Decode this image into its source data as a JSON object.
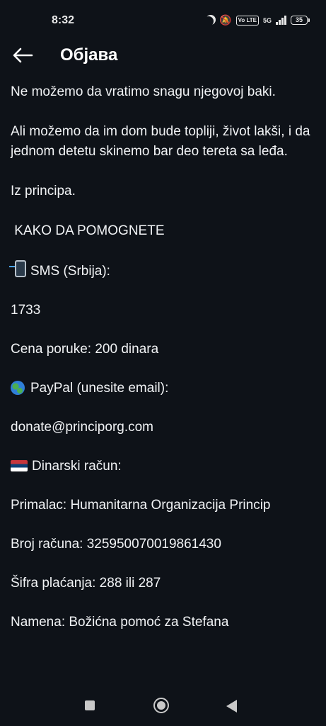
{
  "status_bar": {
    "time": "8:32",
    "network": "5G",
    "volte": "Vo LTE",
    "battery": "35"
  },
  "header": {
    "title": "Објава"
  },
  "post": {
    "line1": "Ne možemo da vratimo snagu njegovoj baki.",
    "para2": "Ali možemo da im dom bude topliji, život lakši, i da jednom detetu skinemo bar deo tereta sa leđa.",
    "para3": "Iz principa.",
    "heading": " KAKO DA POMOGNETE",
    "sms_label": "SMS (Srbija):",
    "sms_number": "1733",
    "sms_price": "Cena poruke: 200 dinara",
    "paypal_label": "PayPal (unesite email):",
    "paypal_email": "donate@principorg.com",
    "dinar_label": "Dinarski račun:",
    "recipient": "Primalac: Humanitarna Organizacija Princip",
    "account": "Broj računa: 325950070019861430",
    "payment_code": "Šifra plaćanja: 288 ili 287",
    "purpose": "Namena: Božićna pomoć za Stefana"
  },
  "icons": {
    "back": "arrow-left-icon",
    "sms": "mobile-phone-arrow-icon",
    "paypal": "globe-icon",
    "dinar": "serbia-flag-icon"
  },
  "colors": {
    "background": "#0e1218",
    "text": "#f1f3f5"
  }
}
